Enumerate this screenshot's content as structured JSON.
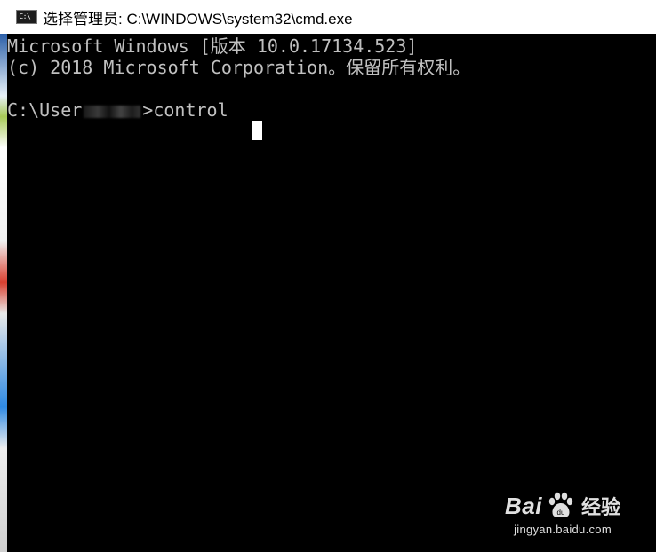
{
  "window": {
    "title": "选择管理员: C:\\WINDOWS\\system32\\cmd.exe",
    "icon_text": "C:\\_"
  },
  "console": {
    "line1": "Microsoft Windows [版本 10.0.17134.523]",
    "line2": "(c) 2018 Microsoft Corporation。保留所有权利。",
    "prompt_prefix": "C:\\User",
    "prompt_suffix": ">control"
  },
  "watermark": {
    "brand_left": "Bai",
    "brand_right": "经验",
    "url": "jingyan.baidu.com"
  },
  "colors": {
    "console_bg": "#000000",
    "console_text": "#c0c0c0",
    "titlebar_bg": "#ffffff"
  }
}
